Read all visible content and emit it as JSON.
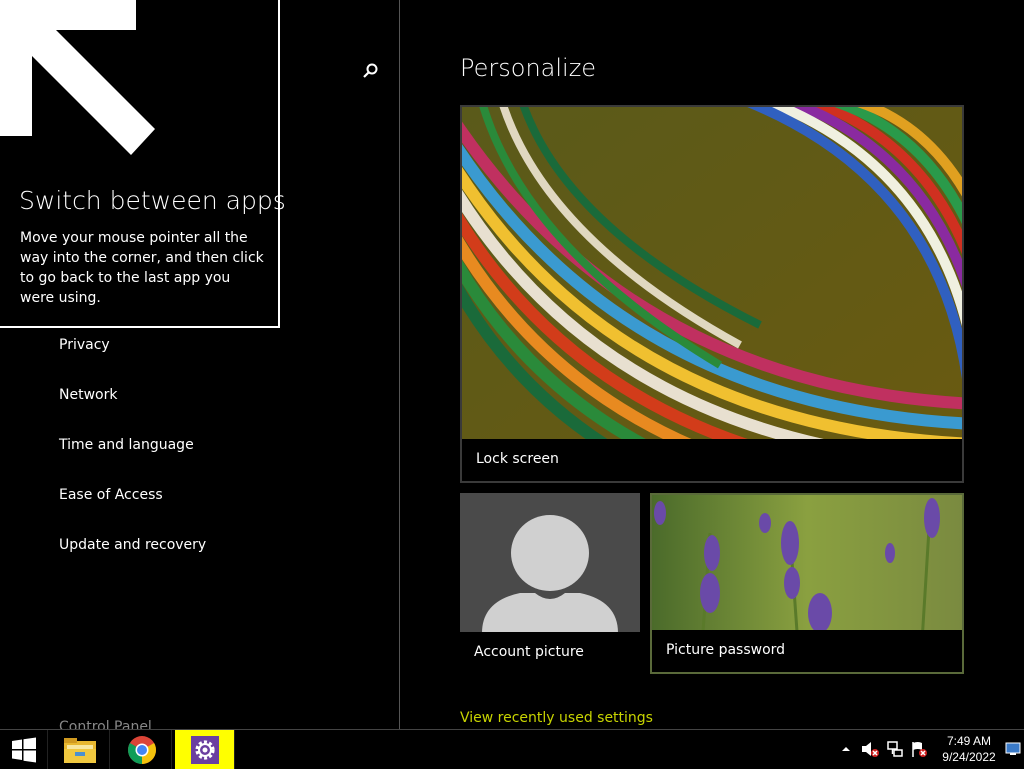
{
  "tooltip": {
    "title": "Switch between apps",
    "body": "Move your mouse pointer all the way into the corner, and then click to go back to the last app you were using."
  },
  "sidebar": {
    "items": [
      {
        "label": "Privacy"
      },
      {
        "label": "Network"
      },
      {
        "label": "Time and language"
      },
      {
        "label": "Ease of Access"
      },
      {
        "label": "Update and recovery"
      }
    ],
    "control_panel": "Control Panel"
  },
  "main": {
    "title": "Personalize",
    "tiles": {
      "lock_screen": "Lock screen",
      "account_picture": "Account picture",
      "picture_password": "Picture password"
    },
    "recent_link": "View recently used settings"
  },
  "taskbar": {
    "time": "7:49 AM",
    "date": "9/24/2022",
    "icons": [
      "start-icon",
      "file-explorer-icon",
      "chrome-icon",
      "settings-icon"
    ],
    "tray_icons": [
      "show-hidden-icons",
      "volume-muted-icon",
      "network-icon",
      "action-center-flag-icon",
      "show-desktop-icon"
    ]
  },
  "colors": {
    "background": "#000000",
    "link": "#c8d400",
    "active_taskbar": "#ffff00",
    "settings_icon": "#6b3fa0"
  }
}
